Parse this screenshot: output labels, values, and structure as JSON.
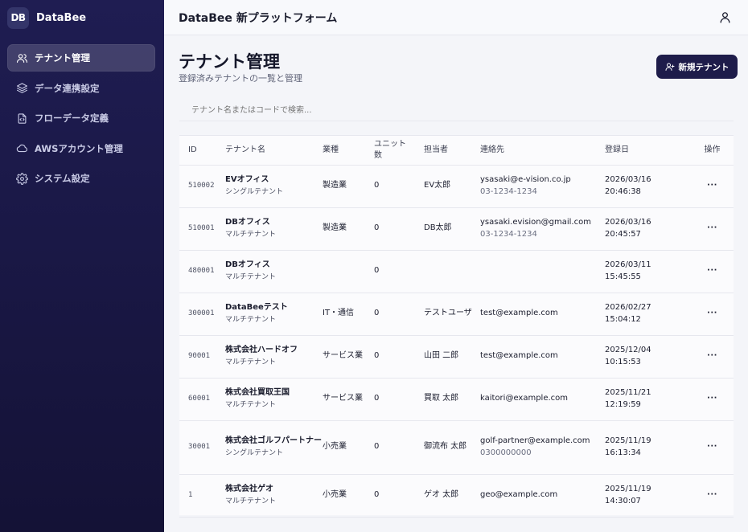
{
  "brand": {
    "logo": "DB",
    "name": "DataBee"
  },
  "nav": [
    {
      "label": "テナント管理",
      "icon": "users-icon",
      "active": true
    },
    {
      "label": "データ連携設定",
      "icon": "layers-icon",
      "active": false
    },
    {
      "label": "フローデータ定義",
      "icon": "file-code-icon",
      "active": false
    },
    {
      "label": "AWSアカウント管理",
      "icon": "cloud-icon",
      "active": false
    },
    {
      "label": "システム設定",
      "icon": "gear-icon",
      "active": false
    }
  ],
  "topbar": {
    "title": "DataBee 新プラットフォーム",
    "user_icon": "user-icon"
  },
  "page": {
    "title": "テナント管理",
    "subtitle": "登録済みテナントの一覧と管理",
    "new_button": "新規テナント"
  },
  "search": {
    "placeholder": "テナント名またはコードで検索..."
  },
  "table": {
    "columns": [
      "ID",
      "テナント名",
      "業種",
      "ユニット数",
      "担当者",
      "連絡先",
      "登録日",
      "操作"
    ],
    "rows": [
      {
        "id": "510002",
        "name": "EVオフィス",
        "type": "シングルテナント",
        "industry": "製造業",
        "units": "0",
        "owner": "EV太郎",
        "email": "ysasaki@e-vision.co.jp",
        "phone": "03-1234-1234",
        "date": "2026/03/16",
        "time": "20:46:38",
        "op": "···"
      },
      {
        "id": "510001",
        "name": "DBオフィス",
        "type": "マルチテナント",
        "industry": "製造業",
        "units": "0",
        "owner": "DB太郎",
        "email": "ysasaki.evision@gmail.com",
        "phone": "03-1234-1234",
        "date": "2026/03/16",
        "time": "20:45:57",
        "op": "···"
      },
      {
        "id": "480001",
        "name": "DBオフィス",
        "type": "マルチテナント",
        "industry": "",
        "units": "0",
        "owner": "",
        "email": "",
        "phone": "",
        "date": "2026/03/11",
        "time": "15:45:55",
        "op": "···"
      },
      {
        "id": "300001",
        "name": "DataBeeテスト",
        "type": "マルチテナント",
        "industry": "IT・通信",
        "units": "0",
        "owner": "テストユーザ",
        "email": "test@example.com",
        "phone": "",
        "date": "2026/02/27",
        "time": "15:04:12",
        "op": "···"
      },
      {
        "id": "90001",
        "name": "株式会社ハードオフ",
        "type": "マルチテナント",
        "industry": "サービス業",
        "units": "0",
        "owner": "山田 二郎",
        "email": "test@example.com",
        "phone": "",
        "date": "2025/12/04",
        "time": "10:15:53",
        "op": "···"
      },
      {
        "id": "60001",
        "name": "株式会社買取王国",
        "type": "マルチテナント",
        "industry": "サービス業",
        "units": "0",
        "owner": "買取 太郎",
        "email": "kaitori@example.com",
        "phone": "",
        "date": "2025/11/21",
        "time": "12:19:59",
        "op": "···"
      },
      {
        "id": "30001",
        "name": "株式会社ゴルフパートナー",
        "type": "シングルテナント",
        "industry": "小売業",
        "units": "0",
        "owner": "御流布 太郎",
        "email": "golf-partner@example.com",
        "phone": "0300000000",
        "date": "2025/11/19",
        "time": "16:13:34",
        "op": "···"
      },
      {
        "id": "1",
        "name": "株式会社ゲオ",
        "type": "マルチテナント",
        "industry": "小売業",
        "units": "0",
        "owner": "ゲオ 太郎",
        "email": "geo@example.com",
        "phone": "",
        "date": "2025/11/19",
        "time": "14:30:07",
        "op": "···"
      }
    ]
  }
}
